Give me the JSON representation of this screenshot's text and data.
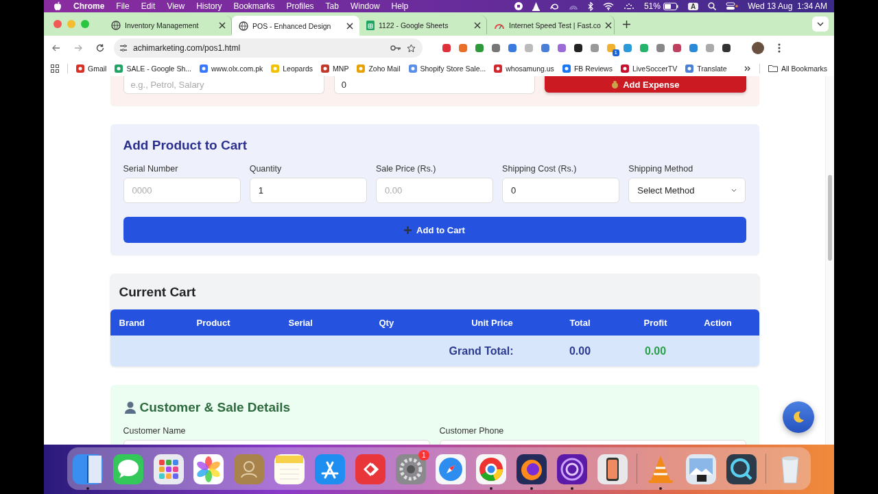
{
  "menubar": {
    "app": "Chrome",
    "menus": [
      "File",
      "Edit",
      "View",
      "History",
      "Bookmarks",
      "Profiles",
      "Tab",
      "Window",
      "Help"
    ],
    "battery": "51%",
    "input_source": "A",
    "clock": "Wed 13 Aug  1:34 AM"
  },
  "tabs": [
    {
      "title": "Inventory Management",
      "selected": false,
      "kind": "globe"
    },
    {
      "title": "POS - Enhanced Design",
      "selected": true,
      "kind": "globe"
    },
    {
      "title": "1122 - Google Sheets",
      "selected": false,
      "kind": "sheet"
    },
    {
      "title": "Internet Speed Test | Fast.co",
      "selected": false,
      "kind": "gauge"
    }
  ],
  "address": "achimarketing.com/pos1.html",
  "extensions": [
    {
      "color": "#e0303a"
    },
    {
      "color": "#e8702a"
    },
    {
      "color": "#2f9a3a"
    },
    {
      "color": "#777777"
    },
    {
      "color": "#3b7be0"
    },
    {
      "color": "#bbbbbb"
    },
    {
      "color": "#4a7fd8"
    },
    {
      "color": "#9b6bd6"
    },
    {
      "color": "#222222"
    },
    {
      "color": "#999999"
    },
    {
      "color": "#f0b030",
      "badge": "1"
    },
    {
      "color": "#2a9bd8"
    },
    {
      "color": "#26b36a"
    },
    {
      "color": "#888888"
    },
    {
      "color": "#c04060"
    },
    {
      "color": "#2a8ad8"
    },
    {
      "color": "#aaaaaa"
    },
    {
      "color": "#333333"
    }
  ],
  "bookmarks": [
    {
      "label": "Gmail",
      "kind": "mail"
    },
    {
      "label": "SALE - Google Sh...",
      "kind": "sheet"
    },
    {
      "label": "www.olx.com.pk",
      "kind": "olx"
    },
    {
      "label": "Leopards",
      "kind": "leopards"
    },
    {
      "label": "MNP",
      "kind": "mnp"
    },
    {
      "label": "Zoho Mail",
      "kind": "zoho"
    },
    {
      "label": "Shopify Store Sale...",
      "kind": "shop"
    },
    {
      "label": "whosamung.us",
      "kind": "whos"
    },
    {
      "label": "FB Reviews",
      "kind": "fb"
    },
    {
      "label": "LiveSoccerTV",
      "kind": "tv"
    },
    {
      "label": "Translate",
      "kind": "translate"
    }
  ],
  "all_bookmarks": "All Bookmarks",
  "expense": {
    "placeholder": "e.g., Petrol, Salary",
    "amount": "0",
    "button": "Add Expense"
  },
  "add_product": {
    "title": "Add Product to Cart",
    "fields": [
      {
        "label": "Serial Number",
        "kind": "input",
        "placeholder": "0000"
      },
      {
        "label": "Quantity",
        "kind": "input",
        "value": "1"
      },
      {
        "label": "Sale Price (Rs.)",
        "kind": "input",
        "placeholder": "0.00"
      },
      {
        "label": "Shipping Cost (Rs.)",
        "kind": "input",
        "value": "0"
      },
      {
        "label": "Shipping Method",
        "kind": "select",
        "value": "Select Method"
      }
    ],
    "button": "Add to Cart"
  },
  "cart": {
    "title": "Current Cart",
    "columns": [
      "Brand",
      "Product",
      "Serial",
      "Qty",
      "Unit Price",
      "Total",
      "Profit",
      "Action"
    ],
    "grand_total_label": "Grand Total:",
    "total": "0.00",
    "profit": "0.00"
  },
  "customer": {
    "title": "Customer & Sale Details",
    "fields": [
      "Customer Name",
      "Customer Phone"
    ]
  },
  "dock": [
    {
      "kind": "finder",
      "running": true
    },
    {
      "kind": "messages",
      "running": false
    },
    {
      "kind": "launchpad",
      "running": false
    },
    {
      "kind": "photos",
      "running": false
    },
    {
      "kind": "contacts",
      "running": false
    },
    {
      "kind": "notes",
      "running": false
    },
    {
      "kind": "appstore",
      "running": false
    },
    {
      "kind": "remote",
      "running": false
    },
    {
      "kind": "settings",
      "running": false,
      "badge": "1"
    },
    {
      "kind": "safari",
      "running": false
    },
    {
      "kind": "chrome",
      "running": true
    },
    {
      "kind": "firefox",
      "running": true
    },
    {
      "kind": "tor",
      "running": true
    },
    {
      "kind": "phone",
      "running": false
    },
    {
      "kind": "separator"
    },
    {
      "kind": "vlc",
      "running": true
    },
    {
      "kind": "preview",
      "running": false
    },
    {
      "kind": "quicktime",
      "running": false
    },
    {
      "kind": "separator"
    },
    {
      "kind": "trash",
      "running": false
    }
  ]
}
